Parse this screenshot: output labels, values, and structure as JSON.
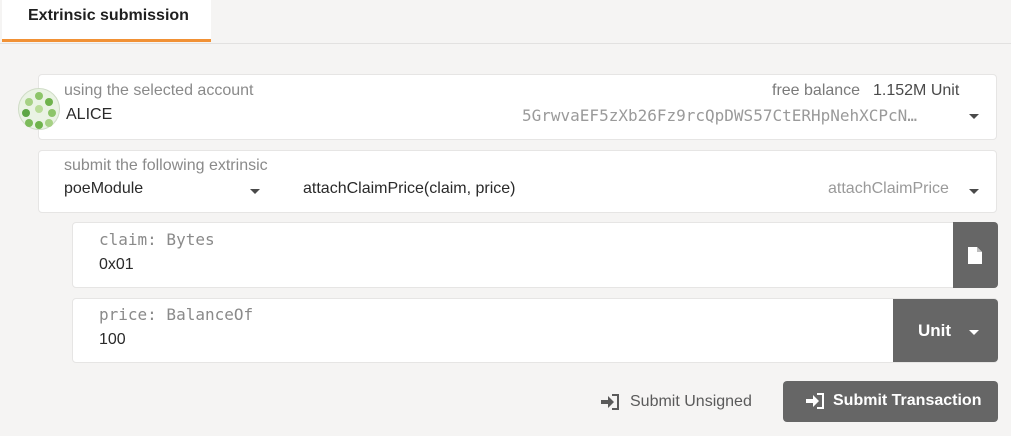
{
  "tabs": [
    {
      "label": "Extrinsic submission",
      "active": true
    }
  ],
  "account": {
    "label": "using the selected account",
    "name": "ALICE",
    "balance_label": "free balance",
    "balance_value": "1.152M Unit",
    "address": "5GrwvaEF5zXb26Fz9rcQpDWS57CtERHpNehXCPcN…"
  },
  "extrinsic": {
    "label": "submit the following extrinsic",
    "module": "poeModule",
    "call_signature": "attachClaimPrice(claim, price)",
    "call_name": "attachClaimPrice"
  },
  "params": [
    {
      "label": "claim: Bytes",
      "value": "0x01",
      "button_icon": "file-icon"
    },
    {
      "label": "price: BalanceOf",
      "value": "100",
      "unit": "Unit"
    }
  ],
  "actions": {
    "submit_unsigned": "Submit Unsigned",
    "submit_transaction": "Submit Transaction"
  },
  "colors": {
    "accent": "#f19135",
    "button_bg": "#666666",
    "background": "#f5f4f3"
  }
}
